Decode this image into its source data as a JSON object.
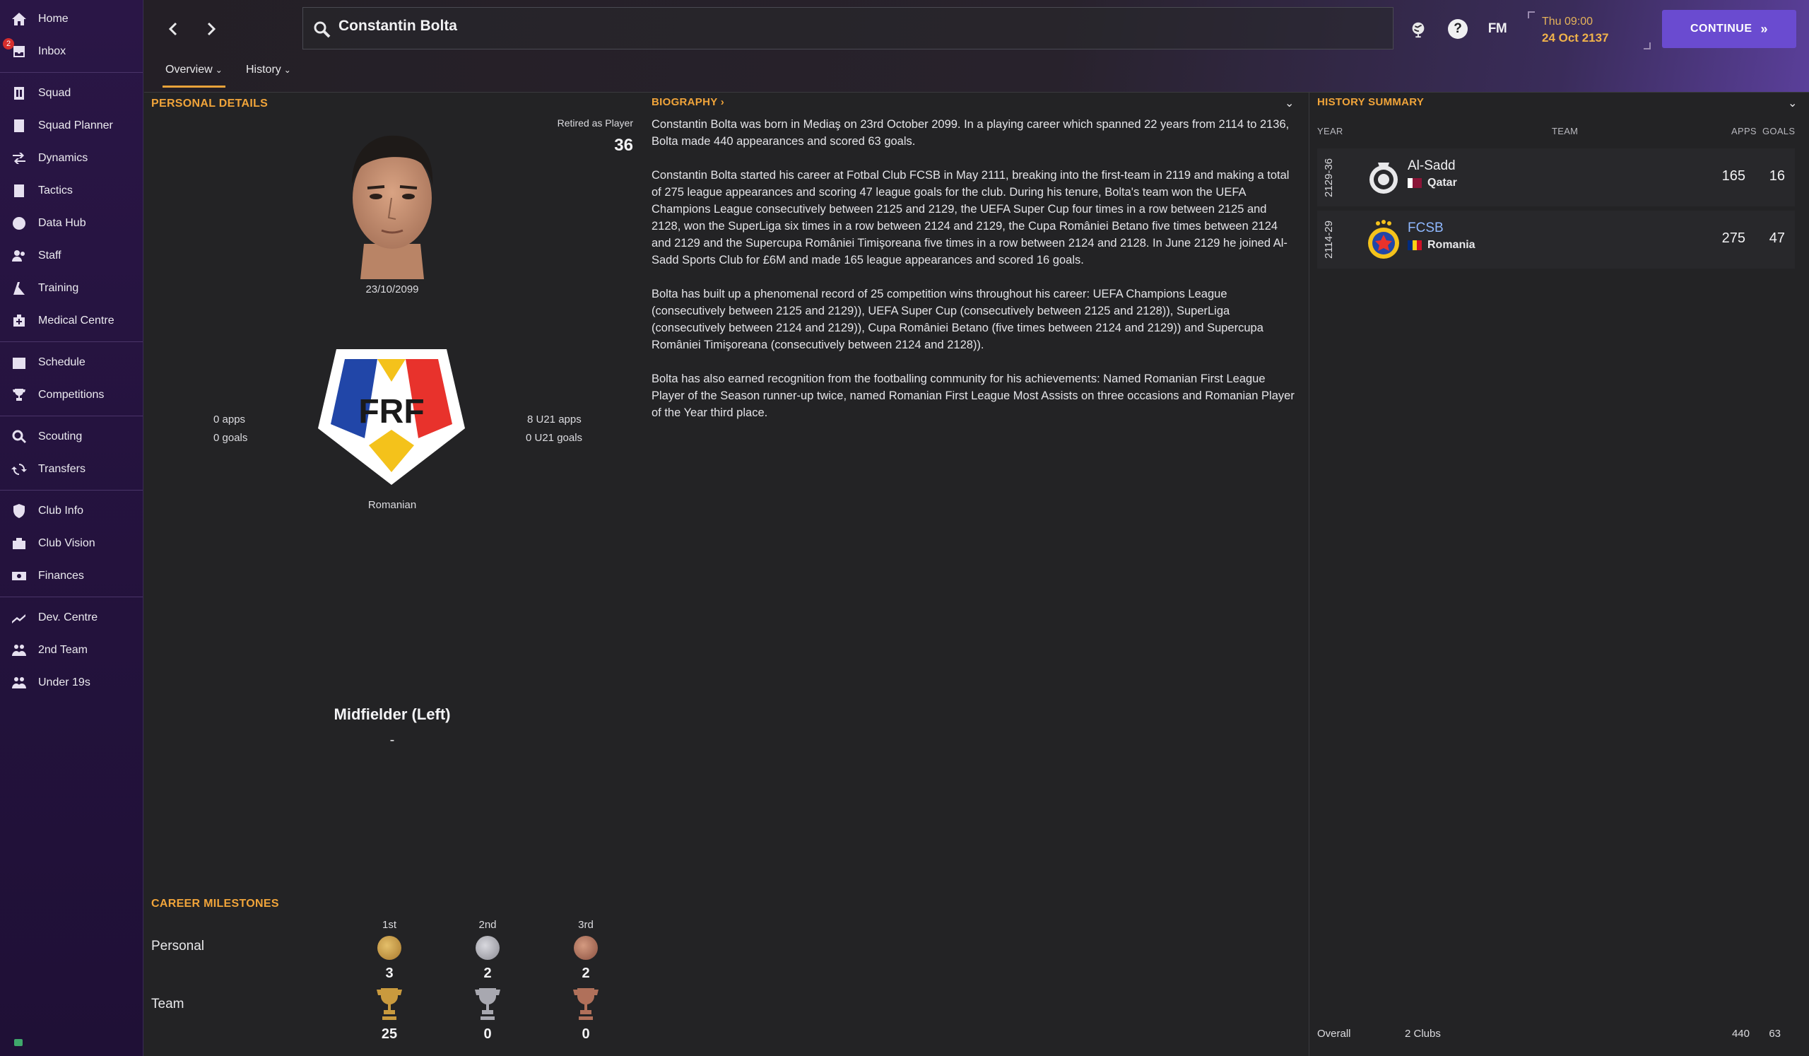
{
  "sidebar": {
    "inbox_badge": "2",
    "items": [
      {
        "label": "Home",
        "icon": "home-icon"
      },
      {
        "label": "Inbox",
        "icon": "inbox-icon"
      },
      {
        "label": "Squad",
        "icon": "squad-icon"
      },
      {
        "label": "Squad Planner",
        "icon": "squad-planner-icon"
      },
      {
        "label": "Dynamics",
        "icon": "dynamics-icon"
      },
      {
        "label": "Tactics",
        "icon": "tactics-icon"
      },
      {
        "label": "Data Hub",
        "icon": "data-hub-icon"
      },
      {
        "label": "Staff",
        "icon": "staff-icon"
      },
      {
        "label": "Training",
        "icon": "training-icon"
      },
      {
        "label": "Medical Centre",
        "icon": "medical-icon"
      },
      {
        "label": "Schedule",
        "icon": "schedule-icon"
      },
      {
        "label": "Competitions",
        "icon": "trophy-icon"
      },
      {
        "label": "Scouting",
        "icon": "scouting-icon"
      },
      {
        "label": "Transfers",
        "icon": "transfers-icon"
      },
      {
        "label": "Club Info",
        "icon": "club-info-icon"
      },
      {
        "label": "Club Vision",
        "icon": "club-vision-icon"
      },
      {
        "label": "Finances",
        "icon": "finances-icon"
      },
      {
        "label": "Dev. Centre",
        "icon": "dev-centre-icon"
      },
      {
        "label": "2nd Team",
        "icon": "second-team-icon"
      },
      {
        "label": "Under 19s",
        "icon": "under-19s-icon"
      }
    ]
  },
  "topbar": {
    "search_value": "Constantin Bolta",
    "time": "Thu 09:00",
    "date": "24 Oct 2137",
    "continue_label": "CONTINUE",
    "fm_label": "FM",
    "help_label": "?",
    "tabs": [
      "Overview",
      "History"
    ]
  },
  "personal": {
    "title": "PERSONAL DETAILS",
    "status": "Retired as Player",
    "age": "36",
    "dob": "23/10/2099",
    "apps": "0 apps",
    "goals": "0 goals",
    "u21_apps": "8 U21 apps",
    "u21_goals": "0 U21 goals",
    "nationality": "Romanian",
    "federation_text": "FRF",
    "position": "Midfielder (Left)",
    "position_sub": "-"
  },
  "biography": {
    "title": "BIOGRAPHY",
    "p1": "Constantin Bolta was born in Mediaş on 23rd October 2099. In a playing career which spanned 22 years from 2114 to 2136, Bolta made 440 appearances and scored 63 goals.",
    "p2": "Constantin Bolta started his career at Fotbal Club FCSB in May 2111, breaking into the first-team in 2119 and making a total of 275 league appearances and scoring 47 league goals for the club. During his tenure, Bolta's team won the UEFA Champions League consecutively between 2125 and 2129, the UEFA Super Cup four times in a row between 2125 and 2128, won the SuperLiga six times in a row between 2124 and 2129, the Cupa României Betano five times between 2124 and 2129 and the Supercupa României Timişoreana five times in a row between 2124 and 2128. In June 2129 he joined Al-Sadd Sports Club for £6M and made 165 league appearances and scored 16 goals.",
    "p3": "Bolta has built up a phenomenal record of 25 competition wins throughout his career: UEFA Champions League (consecutively between 2125 and 2129)), UEFA Super Cup (consecutively between 2125 and 2128)), SuperLiga (consecutively between 2124 and 2129)), Cupa României Betano (five times between 2124 and 2129)) and Supercupa României Timişoreana (consecutively between 2124 and 2128)).",
    "p4": "Bolta has also earned recognition from the footballing community for his achievements: Named Romanian First League Player of the Season runner-up twice, named Romanian First League Most Assists on three occasions and Romanian Player of the Year third place."
  },
  "history": {
    "title": "HISTORY SUMMARY",
    "headers": {
      "year": "YEAR",
      "team": "TEAM",
      "apps": "APPS",
      "goals": "GOALS"
    },
    "rows": [
      {
        "years": "2129-36",
        "team": "Al-Sadd",
        "country": "Qatar",
        "apps": "165",
        "goals": "16"
      },
      {
        "years": "2114-29",
        "team": "FCSB",
        "country": "Romania",
        "apps": "275",
        "goals": "47"
      }
    ],
    "overall": {
      "label": "Overall",
      "clubs": "2 Clubs",
      "apps": "440",
      "goals": "63"
    }
  },
  "milestones": {
    "title": "CAREER MILESTONES",
    "columns": [
      "1st",
      "2nd",
      "3rd"
    ],
    "personal_label": "Personal",
    "team_label": "Team",
    "personal": [
      "3",
      "2",
      "2"
    ],
    "team": [
      "25",
      "0",
      "0"
    ],
    "colors": {
      "gold": "#c99a3e",
      "silver": "#a8a8b0",
      "bronze": "#b0705a"
    }
  }
}
